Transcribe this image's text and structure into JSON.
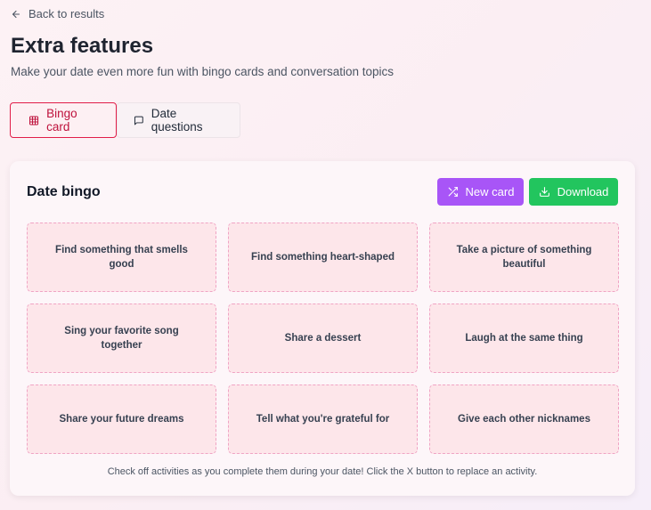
{
  "nav": {
    "back_label": "Back to results"
  },
  "header": {
    "title": "Extra features",
    "subtitle": "Make your date even more fun with bingo cards and conversation topics"
  },
  "tabs": [
    {
      "label": "Bingo card",
      "icon": "grid-icon",
      "active": true
    },
    {
      "label": "Date questions",
      "icon": "message-icon",
      "active": false
    }
  ],
  "bingo": {
    "title": "Date bingo",
    "new_card_label": "New card",
    "download_label": "Download",
    "cells": [
      "Find something that smells good",
      "Find something heart-shaped",
      "Take a picture of something beautiful",
      "Sing your favorite song together",
      "Share a dessert",
      "Laugh at the same thing",
      "Share your future dreams",
      "Tell what you're grateful for",
      "Give each other nicknames"
    ],
    "footer": "Check off activities as you complete them during your date! Click the X button to replace an activity."
  },
  "colors": {
    "accent": "#e11d48",
    "new_card_button": "#a855f7",
    "download_button": "#22c55e",
    "cell_background": "#fde6ea",
    "cell_border": "#f0a4c4"
  }
}
